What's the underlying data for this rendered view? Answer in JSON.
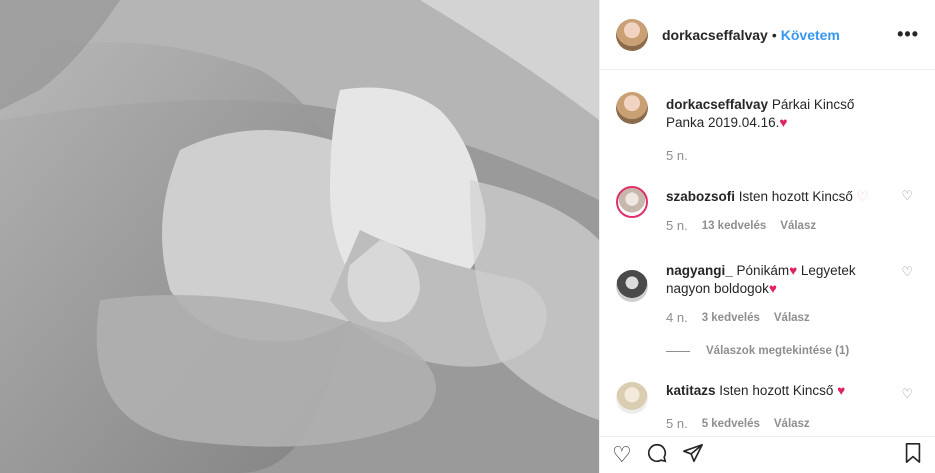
{
  "post": {
    "image_alt": "",
    "author": "dorkacseffalvay",
    "separator": "•",
    "follow_label": "Követem",
    "more_label": "•••"
  },
  "caption": {
    "username": "dorkacseffalvay",
    "text": "Párkai Kincső Panka 2019.04.16.",
    "heart": "♥",
    "time": "5 n."
  },
  "comments": [
    {
      "username": "szabozsofi",
      "text": "Isten hozott Kincső",
      "heart": "♡",
      "time": "5 n.",
      "likes": "13 kedvelés",
      "reply": "Válasz"
    },
    {
      "username": "nagyangi_",
      "text": "Pónikám",
      "heart1": "♥",
      "text2": "Legyetek nagyon boldogok",
      "heart2": "♥",
      "time": "4 n.",
      "likes": "3 kedvelés",
      "reply": "Válasz",
      "view_replies": "Válaszok megtekintése (1)"
    },
    {
      "username": "katitazs",
      "text": "Isten hozott Kincső",
      "heart": "♥",
      "time": "5 n.",
      "likes": "5 kedvelés",
      "reply": "Válasz"
    }
  ],
  "icons": {
    "heart": "♡",
    "comment": "◯",
    "share": "➤",
    "bookmark": "⛉"
  },
  "colors": {
    "accent": "#3897f0",
    "text": "#262626",
    "muted": "#8e8e8e",
    "heart_red": "#e0245e"
  }
}
